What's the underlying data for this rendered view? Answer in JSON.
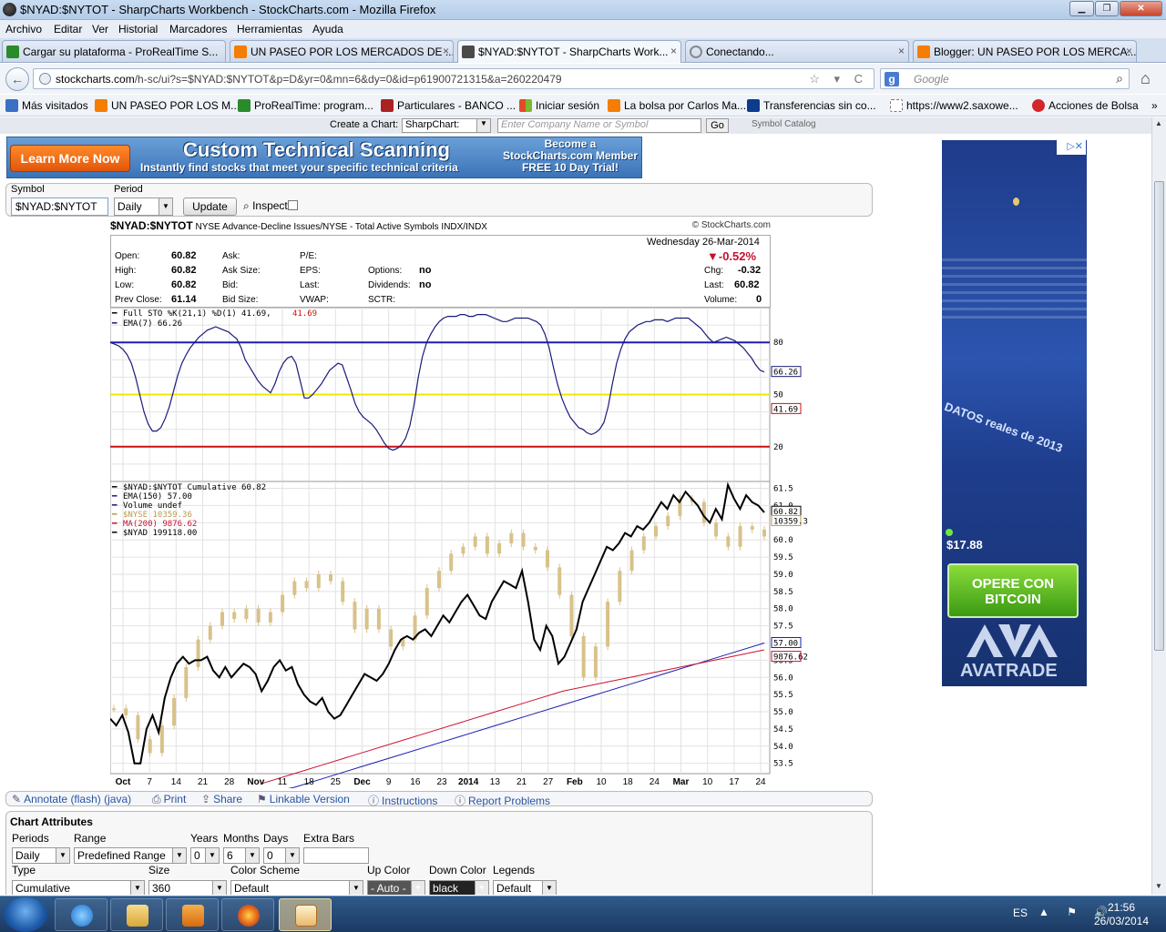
{
  "window": {
    "title": "$NYAD:$NYTOT - SharpCharts Workbench - StockCharts.com - Mozilla Firefox",
    "min": "▁",
    "max": "❐",
    "close": "✕"
  },
  "menu": [
    "Archivo",
    "Editar",
    "Ver",
    "Historial",
    "Marcadores",
    "Herramientas",
    "Ayuda"
  ],
  "tabs": [
    {
      "label": "Cargar su plataforma - ProRealTime S...",
      "color": "#2a8b2a"
    },
    {
      "label": "UN PASEO POR LOS MERCADOS DE ...",
      "color": "#f57d00"
    },
    {
      "label": "$NYAD:$NYTOT - SharpCharts Work...",
      "color": "#4a4a4a"
    },
    {
      "label": "Conectando...",
      "color": "#888888"
    },
    {
      "label": "Blogger: UN PASEO POR LOS MERCA...",
      "color": "#f57d00"
    }
  ],
  "tab_close": "×",
  "tab_new": "+",
  "nav": {
    "back": "←",
    "url_host": "stockcharts.com",
    "url_rest": "/h-sc/ui?s=$NYAD:$NYTOT&p=D&yr=0&mn=6&dy=0&id=p61900721315&a=260220479",
    "url_icons": "☆ ▾ C",
    "search_engine": "g",
    "search_placeholder": "Google",
    "search_icon": "⌕",
    "home": "⌂"
  },
  "bookmarks": [
    {
      "label": "Más visitados",
      "color": "#3a6fc4"
    },
    {
      "label": "UN PASEO POR LOS M...",
      "color": "#f57d00"
    },
    {
      "label": "ProRealTime: program...",
      "color": "#2a8b2a"
    },
    {
      "label": "Particulares - BANCO ...",
      "color": "#aa2222"
    },
    {
      "label": "Iniciar sesión",
      "color": "#e24a28"
    },
    {
      "label": "La bolsa por Carlos Ma...",
      "color": "#f57d00"
    },
    {
      "label": "Transferencias sin co...",
      "color": "#0c3c8c"
    },
    {
      "label": "https://www2.saxowe...",
      "color": "#ffffff"
    },
    {
      "label": "Acciones de Bolsa",
      "color": "#d4252a"
    }
  ],
  "bookmarks_more": "»",
  "create": {
    "label": "Create a Chart:",
    "type": "SharpChart:",
    "placeholder": "Enter Company Name or Symbol",
    "go": "Go",
    "catalog": "Symbol Catalog"
  },
  "banner": {
    "learn": "Learn More Now",
    "title": "Custom Technical Scanning",
    "subtitle": "Instantly find stocks that meet your specific technical criteria",
    "member": "Become a StockCharts.com Member FREE 10 Day Trial!"
  },
  "symbol_panel": {
    "symbol_label": "Symbol",
    "symbol_value": "$NYAD:$NYTOT",
    "period_label": "Period",
    "period_value": "Daily",
    "update": "Update",
    "inspect": "Inspect"
  },
  "chart_head": {
    "symbol": "$NYAD:$NYTOT",
    "desc": "NYSE Advance-Decline Issues/NYSE - Total Active Symbols  INDX/INDX",
    "source": "© StockCharts.com"
  },
  "quote": {
    "open_label": "Open:",
    "open": "60.82",
    "high_label": "High:",
    "high": "60.82",
    "low_label": "Low:",
    "low": "60.82",
    "prev_label": "Prev Close:",
    "prev": "61.14",
    "ask_label": "Ask:",
    "asksize_label": "Ask Size:",
    "bid_label": "Bid:",
    "bidsize_label": "Bid Size:",
    "pe_label": "P/E:",
    "eps_label": "EPS:",
    "last_label": "Last:",
    "vwap_label": "VWAP:",
    "options_label": "Options:",
    "options": "no",
    "dividends_label": "Dividends:",
    "dividends": "no",
    "sctr_label": "SCTR:",
    "date": "Wednesday  26-Mar-2014",
    "pct": "-0.52%",
    "chg_label": "Chg:",
    "chg": "-0.32",
    "last2_label": "Last:",
    "last2": "60.82",
    "volume_label": "Volume:",
    "volume": "0"
  },
  "chart_data": [
    {
      "type": "line",
      "legend": [
        "Full STO %K(21,1) %D(1) 41.69,",
        "41.69",
        "EMA(7) 66.26"
      ],
      "ylim": [
        0,
        100
      ],
      "levels": [
        {
          "value": 80,
          "label": "80",
          "color": "#1c1cb4"
        },
        {
          "value": 50,
          "label": "50",
          "color": "#f2e600"
        },
        {
          "value": 20,
          "label": "20",
          "color": "#cc1111"
        }
      ],
      "last_labels": [
        "66.26",
        "41.69"
      ],
      "series": [
        {
          "name": "EMA(7) 66.26",
          "color": "#1a1a7a",
          "values": [
            80,
            79,
            78,
            76,
            73,
            68,
            60,
            50,
            40,
            33,
            29,
            29,
            31,
            36,
            43,
            52,
            61,
            68,
            73,
            77,
            80,
            83,
            85,
            87,
            88,
            89,
            88,
            87,
            86,
            84,
            82,
            77,
            70,
            66,
            62,
            58,
            55,
            53,
            51,
            56,
            63,
            68,
            71,
            72,
            68,
            58,
            48,
            48,
            50,
            53,
            56,
            60,
            64,
            66,
            68,
            67,
            60,
            53,
            45,
            40,
            37,
            35,
            33,
            30,
            26,
            22,
            19,
            18,
            19,
            21,
            25,
            32,
            44,
            60,
            72,
            80,
            85,
            89,
            92,
            94,
            95,
            95,
            95,
            96,
            96,
            95,
            95,
            96,
            96,
            96,
            95,
            94,
            93,
            92,
            92,
            93,
            94,
            94,
            94,
            94,
            93,
            92,
            90,
            85,
            77,
            66,
            56,
            48,
            42,
            37,
            34,
            31,
            30,
            28,
            27,
            28,
            30,
            34,
            43,
            56,
            68,
            76,
            82,
            86,
            88,
            90,
            91,
            92,
            92,
            93,
            93,
            93,
            92,
            93,
            94,
            94,
            94,
            94,
            92,
            90,
            88,
            85,
            82,
            80,
            81,
            82,
            83,
            82,
            81,
            79,
            77,
            74,
            71,
            67,
            64,
            63
          ]
        }
      ],
      "x_ticks": [
        "Oct",
        "7",
        "14",
        "21",
        "28",
        "Nov",
        "11",
        "18",
        "25",
        "Dec",
        "9",
        "16",
        "23",
        "2014",
        "13",
        "21",
        "27",
        "Feb",
        "10",
        "18",
        "24",
        "Mar",
        "10",
        "17",
        "24"
      ]
    },
    {
      "type": "line",
      "legend": [
        "$NYAD:$NYTOT Cumulative 60.82",
        "EMA(150) 57.00",
        "Volume undef",
        "$NYSE 10359.36",
        "MA(200) 9876.62",
        "$NYAD 199118.00"
      ],
      "ylim": [
        53.2,
        61.7
      ],
      "y_ticks": [
        "61.5",
        "61.0",
        "60.5",
        "60.0",
        "59.5",
        "59.0",
        "58.5",
        "58.0",
        "57.5",
        "57.0",
        "56.5",
        "56.0",
        "55.5",
        "55.0",
        "54.5",
        "54.0",
        "53.5"
      ],
      "last_labels": [
        "60.82",
        "10359.3",
        "57.00",
        "9876.62"
      ],
      "x_ticks": [
        "Oct",
        "7",
        "14",
        "21",
        "28",
        "Nov",
        "11",
        "18",
        "25",
        "Dec",
        "9",
        "16",
        "23",
        "2014",
        "13",
        "21",
        "27",
        "Feb",
        "10",
        "18",
        "24",
        "Mar",
        "10",
        "17",
        "24"
      ],
      "series": [
        {
          "name": "$NYAD:$NYTOT Cumulative 60.82",
          "color": "#000000",
          "values": [
            54.8,
            54.6,
            54.9,
            54.4,
            53.5,
            53.5,
            54.5,
            54.9,
            54.4,
            55.4,
            56.0,
            56.4,
            56.6,
            56.4,
            56.5,
            56.5,
            56.6,
            56.2,
            56.0,
            56.3,
            56.0,
            56.2,
            56.4,
            56.3,
            56.1,
            55.6,
            55.9,
            56.3,
            56.5,
            56.2,
            56.3,
            55.8,
            55.5,
            55.3,
            55.2,
            55.4,
            55.0,
            54.8,
            54.9,
            55.2,
            55.5,
            55.8,
            56.1,
            56.0,
            55.9,
            56.1,
            56.4,
            56.8,
            57.1,
            57.2,
            57.1,
            57.3,
            57.4,
            57.2,
            57.5,
            57.8,
            57.6,
            57.9,
            58.2,
            58.4,
            58.1,
            57.8,
            57.7,
            58.2,
            58.5,
            58.8,
            58.7,
            58.6,
            59.1,
            58.2,
            57.1,
            56.8,
            57.5,
            57.2,
            56.4,
            56.6,
            57.0,
            57.4,
            58.2,
            58.6,
            59.0,
            59.4,
            59.8,
            59.7,
            59.9,
            60.2,
            60.1,
            60.4,
            60.3,
            60.5,
            60.8,
            61.1,
            60.9,
            61.3,
            61.1,
            61.4,
            61.2,
            61.0,
            60.7,
            60.5,
            60.9,
            60.6,
            61.6,
            61.2,
            60.9,
            61.3,
            61.1,
            61.0,
            60.8
          ]
        },
        {
          "name": "EMA(150) 57.00",
          "color": "#1c1cb4",
          "values": [
            52.6,
            52.8,
            53.1,
            53.4,
            53.7,
            54.0,
            54.3,
            54.6,
            54.9,
            55.2,
            55.5,
            55.8,
            56.1,
            56.4,
            56.7,
            57.0
          ]
        },
        {
          "name": "MA(200) 9876.62",
          "color": "#cc1133",
          "values": [
            52.9,
            53.2,
            53.5,
            53.8,
            54.1,
            54.4,
            54.7,
            55.0,
            55.3,
            55.6,
            55.8,
            56.0,
            56.2,
            56.4,
            56.6,
            56.8
          ]
        },
        {
          "name": "$NYSE 10359.36",
          "color": "#d8c28a",
          "values": [
            55.1,
            54.9,
            54.2,
            53.8,
            54.6,
            55.4,
            56.3,
            57.1,
            57.5,
            57.9,
            57.7,
            58.0,
            57.6,
            57.9,
            58.4,
            58.8,
            58.6,
            59.0,
            58.8,
            58.2,
            57.4,
            58.0,
            57.4,
            56.9,
            57.1,
            57.8,
            58.6,
            59.1,
            59.6,
            59.8,
            60.1,
            59.6,
            59.9,
            60.2,
            59.8,
            59.7,
            59.2,
            58.4,
            57.2,
            56.0,
            56.9,
            58.2,
            59.1,
            59.7,
            60.1,
            60.4,
            60.7,
            61.2,
            61.1,
            60.5,
            60.1,
            59.8,
            60.4,
            60.3,
            60.1
          ]
        }
      ]
    }
  ],
  "tools": [
    {
      "icon": "✎",
      "label": "Annotate (flash) (java)"
    },
    {
      "icon": "⎙",
      "label": "Print"
    },
    {
      "icon": "⇪",
      "label": "Share"
    },
    {
      "icon": "⚑",
      "label": "Linkable Version"
    },
    {
      "icon": "ⓘ",
      "label": "Instructions"
    },
    {
      "icon": "ⓘ",
      "label": "Report Problems"
    }
  ],
  "attrs": {
    "title": "Chart Attributes",
    "periods_label": "Periods",
    "periods": "Daily",
    "range_label": "Range",
    "range": "Predefined Range",
    "years_label": "Years",
    "years": "0",
    "months_label": "Months",
    "months": "6",
    "days_label": "Days",
    "days": "0",
    "extra_label": "Extra Bars",
    "type_label": "Type",
    "type": "Cumulative",
    "size_label": "Size",
    "size": "360",
    "scheme_label": "Color Scheme",
    "scheme": "Default",
    "up_label": "Up Color",
    "up": "- Auto -",
    "down_label": "Down Color",
    "down": "black",
    "legends_label": "Legends",
    "legends": "Default"
  },
  "ad": {
    "close": "▷✕",
    "datos": "DATOS reales de 2013",
    "price": "$17.88",
    "opere": "OPERE CON BITCOIN",
    "brand": "AVATRADE"
  },
  "taskbar": {
    "lang": "ES",
    "tray": "▲ ⚑ 🔊",
    "time": "21:56",
    "date": "26/03/2014"
  }
}
